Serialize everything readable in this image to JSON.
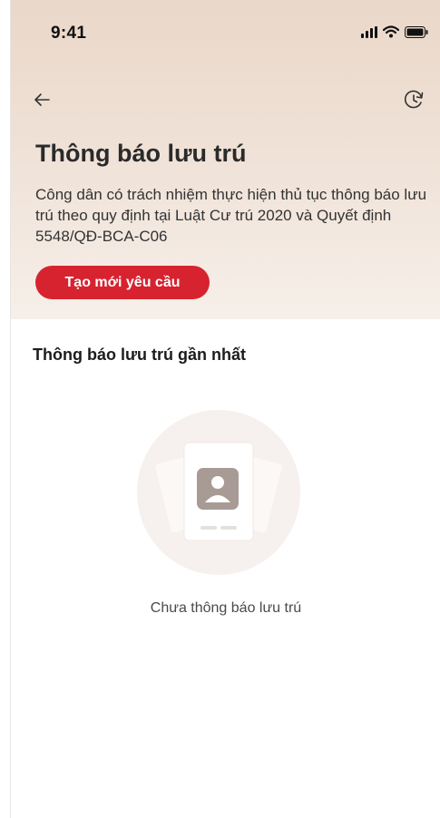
{
  "status_bar": {
    "time": "9:41",
    "icons": [
      "signal-icon",
      "wifi-icon",
      "battery-icon"
    ]
  },
  "nav": {
    "back_icon": "arrow-left-icon",
    "history_icon": "history-icon"
  },
  "header": {
    "title": "Thông báo lưu trú",
    "description": "Công dân có trách nhiệm thực hiện thủ tục thông báo lưu trú theo quy định tại Luật Cư trú 2020 và Quyết định 5548/QĐ-BCA-C06",
    "create_button_label": "Tạo mới yêu cầu"
  },
  "recent": {
    "section_title": "Thông báo lưu trú gần nhất",
    "empty_icon": "document-person-icon",
    "empty_text": "Chưa thông báo lưu trú"
  },
  "colors": {
    "accent": "#d7232f",
    "header_gradient_top": "#ead8c9",
    "header_gradient_bottom": "#f6efe9"
  }
}
